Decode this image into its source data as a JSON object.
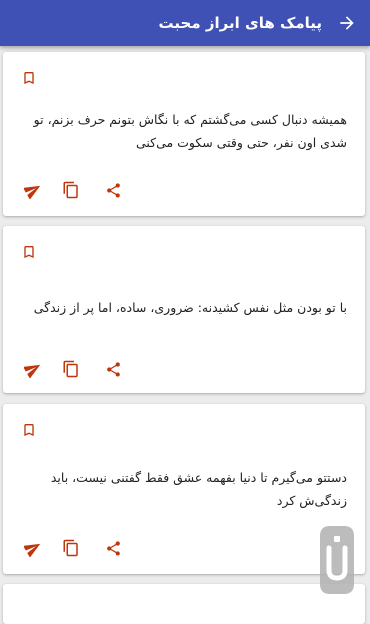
{
  "appbar": {
    "title": "پیامک های ابراز محبت",
    "back_icon": "arrow-right-icon"
  },
  "messages": [
    {
      "text": "همیشه دنبال کسی می‌گشتم که با نگاش بتونم حرف بزنم، تو شدی اون نفر، حتی وقتی سکوت می‌کنی"
    },
    {
      "text": "با تو بودن مثل نفس کشیدنه: ضروری، ساده، اما پر از زندگی"
    },
    {
      "text": "دستتو می‌گیرم تا دنیا بفهمه عشق فقط گفتنی نیست، باید زندگی‌ش کرد"
    }
  ],
  "icons": {
    "bookmark": "bookmark-icon",
    "send": "send-icon",
    "copy": "copy-icon",
    "share": "share-icon"
  },
  "colors": {
    "appbar": "#3f51b5",
    "accent": "#bf360c",
    "background": "#ececec",
    "card": "#ffffff",
    "text": "#212121"
  }
}
